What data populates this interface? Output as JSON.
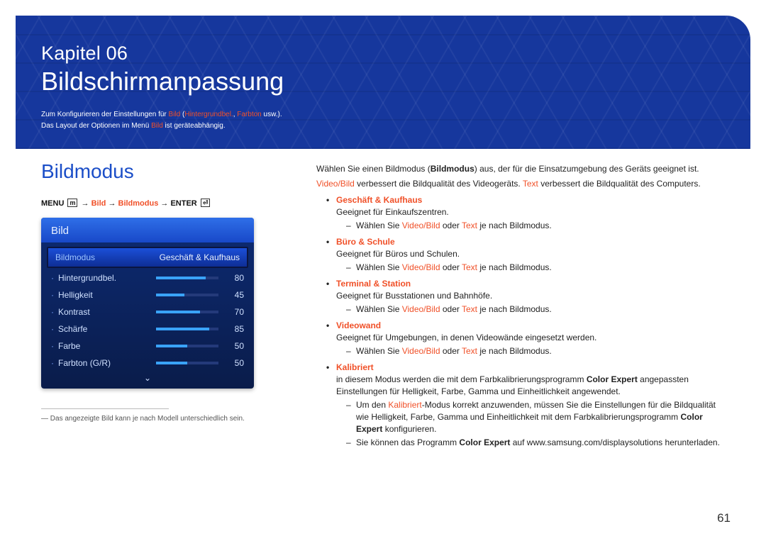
{
  "chapter_line": "Kapitel 06",
  "chapter_title": "Bildschirmanpassung",
  "intro_pre": "Zum Konfigurieren der Einstellungen für ",
  "intro_hl1": "Bild",
  "intro_mid1": " (",
  "intro_hl2": "Hintergrundbel.",
  "intro_mid2": ", ",
  "intro_hl3": "Farbton",
  "intro_post": " usw.).",
  "intro_line2_pre": "Das Layout der Optionen im Menü ",
  "intro_line2_hl": "Bild",
  "intro_line2_post": " ist geräteabhängig.",
  "section_heading": "Bildmodus",
  "bc_menu": "MENU",
  "bc_menu_glyph": "m",
  "bc_arrow": "→",
  "bc_p1": "Bild",
  "bc_p2": "Bildmodus",
  "bc_enter": "ENTER",
  "bc_enter_glyph": "⏎",
  "osd": {
    "title": "Bild",
    "sel_label": "Bildmodus",
    "sel_value": "Geschäft & Kaufhaus",
    "rows": [
      {
        "name": "Hintergrundbel.",
        "value": 80
      },
      {
        "name": "Helligkeit",
        "value": 45
      },
      {
        "name": "Kontrast",
        "value": 70
      },
      {
        "name": "Schärfe",
        "value": 85
      },
      {
        "name": "Farbe",
        "value": 50
      },
      {
        "name": "Farbton (G/R)",
        "value": 50
      }
    ],
    "more_glyph": "⌄"
  },
  "footnote": "Das angezeigte Bild kann je nach Modell unterschiedlich sein.",
  "footnote_dash": "―",
  "right": {
    "p1_a": "Wählen Sie einen Bildmodus (",
    "p1_b": "Bildmodus",
    "p1_c": ") aus, der für die Einsatzumgebung des Geräts geeignet ist.",
    "p2_a": "Video/Bild",
    "p2_b": " verbessert die Bildqualität des Videogeräts. ",
    "p2_c": "Text",
    "p2_d": " verbessert die Bildqualität des Computers.",
    "modes": [
      {
        "name": "Geschäft & Kaufhaus",
        "desc": "Geeignet für Einkaufszentren.",
        "sub_pre": "Wählen Sie ",
        "sub_h1": "Video/Bild",
        "sub_mid": " oder ",
        "sub_h2": "Text",
        "sub_post": " je nach Bildmodus."
      },
      {
        "name": "Büro & Schule",
        "desc": "Geeignet für Büros und Schulen.",
        "sub_pre": "Wählen Sie ",
        "sub_h1": "Video/Bild",
        "sub_mid": " oder ",
        "sub_h2": "Text",
        "sub_post": " je nach Bildmodus."
      },
      {
        "name": "Terminal & Station",
        "desc": "Geeignet für Busstationen und Bahnhöfe.",
        "sub_pre": "Wählen Sie ",
        "sub_h1": "Video/Bild",
        "sub_mid": " oder ",
        "sub_h2": "Text",
        "sub_post": " je nach Bildmodus."
      },
      {
        "name": "Videowand",
        "desc": "Geeignet für Umgebungen, in denen Videowände eingesetzt werden.",
        "sub_pre": "Wählen Sie ",
        "sub_h1": "Video/Bild",
        "sub_mid": " oder ",
        "sub_h2": "Text",
        "sub_post": " je nach Bildmodus."
      }
    ],
    "kalibriert": {
      "name": "Kalibriert",
      "desc_a": "in diesem Modus werden die mit dem Farbkalibrierungsprogramm ",
      "desc_b": "Color Expert",
      "desc_c": " angepassten Einstellungen für Helligkeit, Farbe, Gamma und Einheitlichkeit angewendet.",
      "s1_a": "Um den ",
      "s1_b": "Kalibriert",
      "s1_c": "-Modus korrekt anzuwenden, müssen Sie die Einstellungen für die Bildqualität wie Helligkeit, Farbe, Gamma und Einheitlichkeit mit dem Farbkalibrierungsprogramm ",
      "s1_d": "Color Expert",
      "s1_e": " konfigurieren.",
      "s2_a": "Sie können das Programm ",
      "s2_b": "Color Expert",
      "s2_c": " auf www.samsung.com/displaysolutions herunterladen."
    }
  },
  "page_number": "61"
}
